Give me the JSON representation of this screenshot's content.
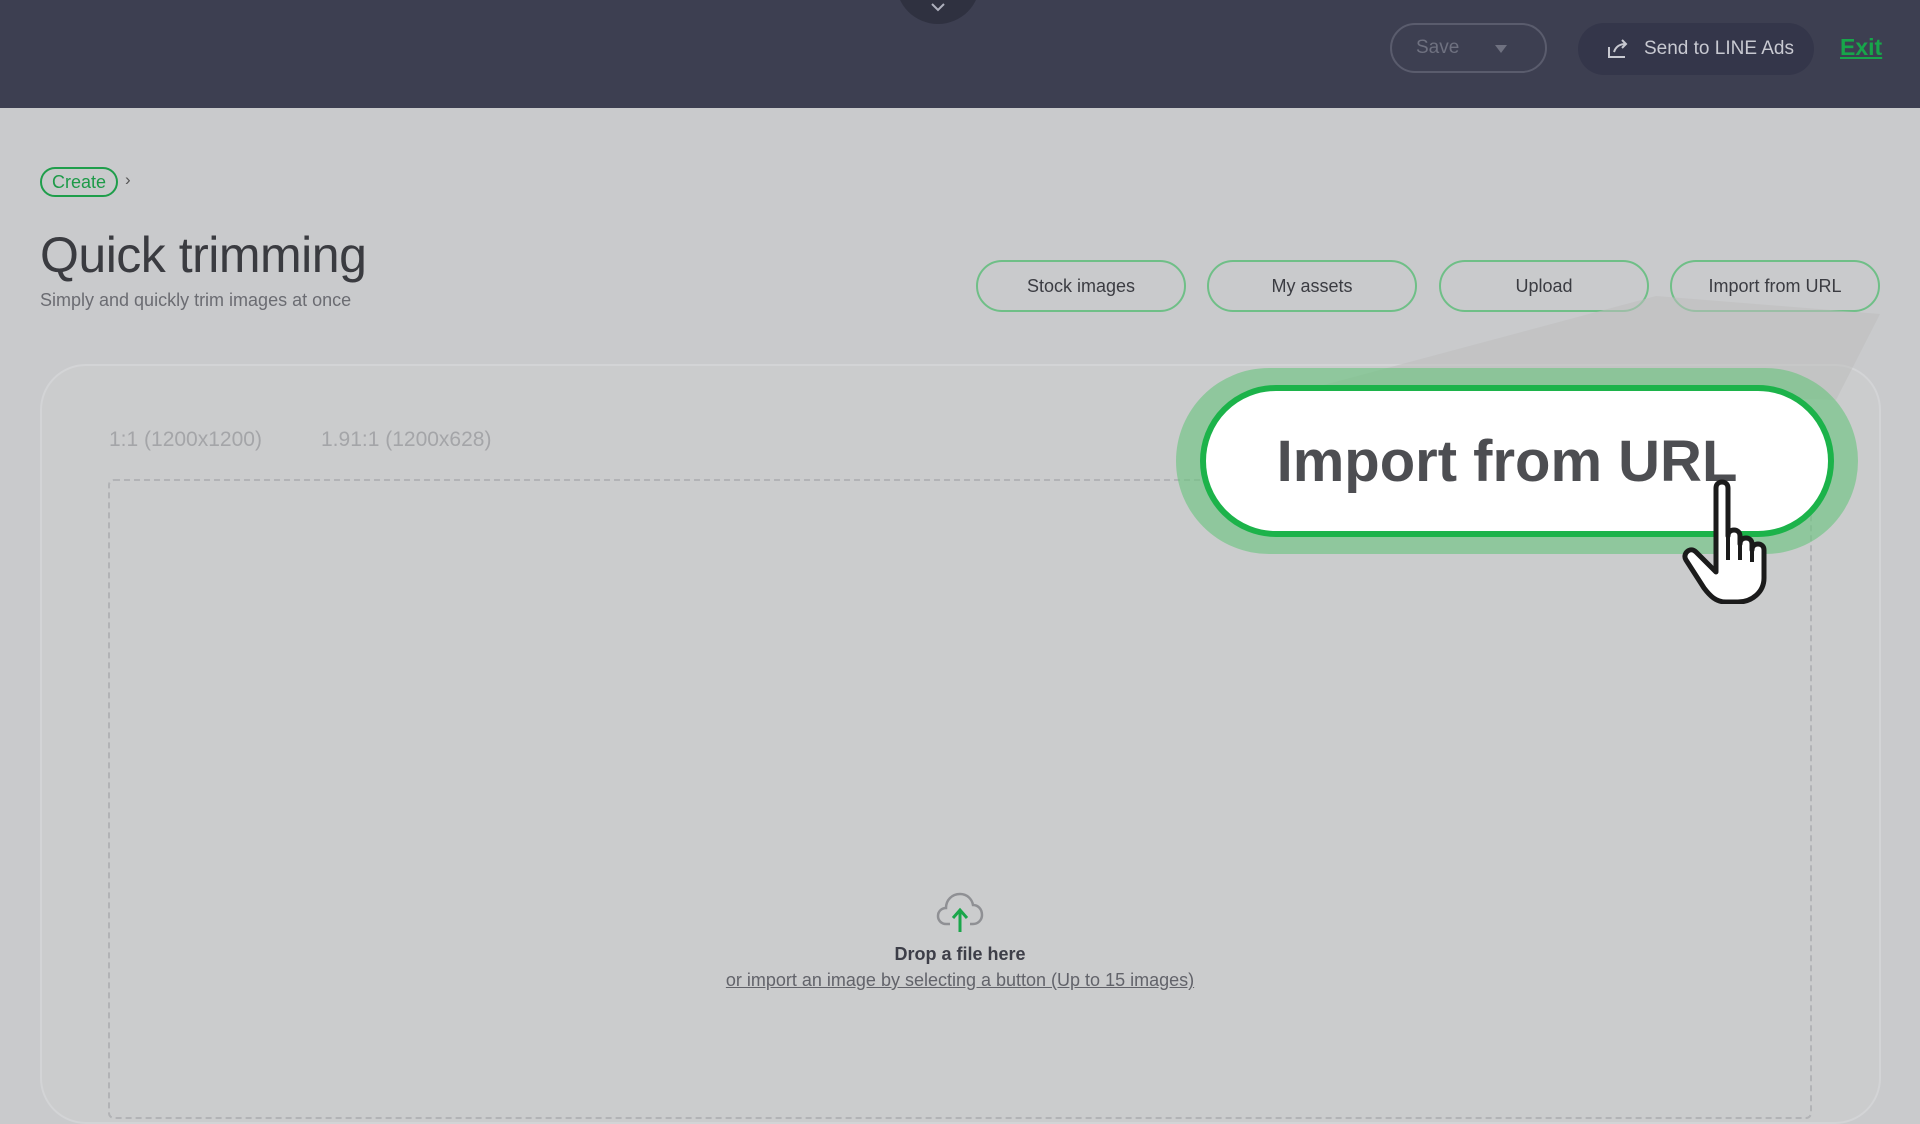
{
  "header": {
    "save_label": "Save",
    "send_label": "Send to LINE Ads",
    "exit_label": "Exit"
  },
  "breadcrumb": {
    "create_label": "Create",
    "separator": "›"
  },
  "page": {
    "title": "Quick trimming",
    "subtitle": "Simply and quickly trim images at once"
  },
  "import_buttons": [
    "Stock images",
    "My assets",
    "Upload",
    "Import from URL"
  ],
  "ratios": [
    "1:1 (1200x1200)",
    "1.91:1 (1200x628)"
  ],
  "dropzone": {
    "title": "Drop a file here",
    "subtitle": "or import an image by selecting a button (Up to 15 images)"
  },
  "callout": {
    "label": "Import from URL"
  },
  "colors": {
    "accent": "#1cb34a",
    "header_bg": "#3d3f51",
    "page_bg": "#c9cacc"
  },
  "icons": {
    "share": "share-icon",
    "caret": "caret-down-icon",
    "upload": "cloud-upload-icon",
    "cursor": "hand-pointer-icon"
  }
}
